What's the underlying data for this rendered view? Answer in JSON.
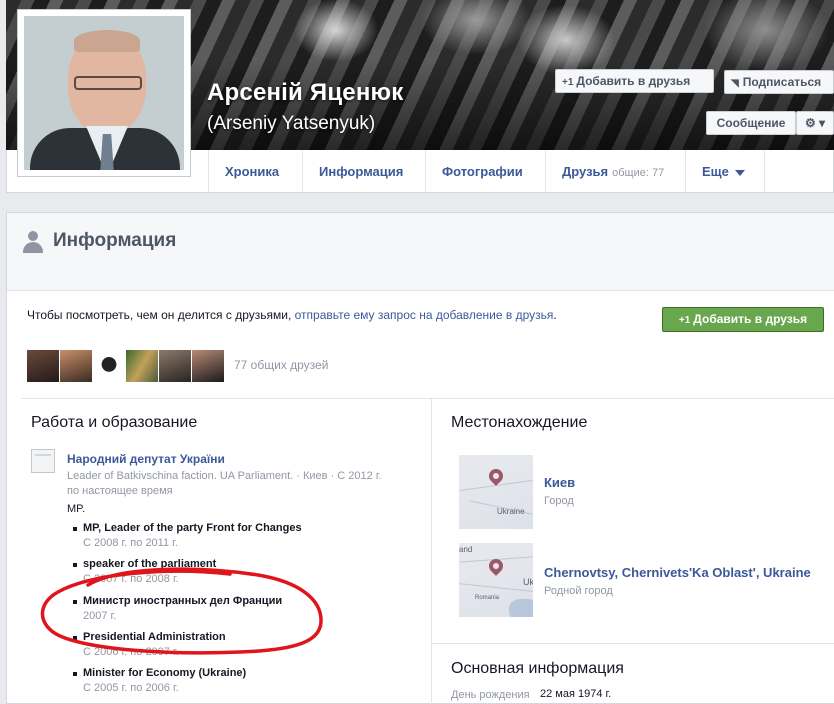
{
  "profile": {
    "name": "Арсеній Яценюк",
    "alt_name": "(Arseniy Yatsenyuk)"
  },
  "header_actions": {
    "add_friend": "Добавить в друзья",
    "add_friend_prefix": "+1",
    "subscribe": "Подписаться",
    "message": "Сообщение",
    "gear": "⚙ ▾"
  },
  "tabs": [
    {
      "label": "Хроника"
    },
    {
      "label": "Информация"
    },
    {
      "label": "Фотографии"
    },
    {
      "label": "Друзья",
      "count": "общие: 77"
    },
    {
      "label": "Еще"
    }
  ],
  "info": {
    "title": "Информация",
    "request_text": "Чтобы посмотреть, чем он делится с друзьями, ",
    "request_link": "отправьте ему запрос на добавление в друзья",
    "request_end": ".",
    "add_friend_button": "Добавить в друзья",
    "add_friend_prefix": "+1",
    "mutual_friends": "77 общих друзей"
  },
  "work": {
    "title": "Работа и образование",
    "job_title": "Народний депутат України",
    "job_desc": "Leader of Batkivschina faction. UA Parliament. · Киев · С 2012 г. по настоящее время",
    "job_role": "MP.",
    "positions": [
      {
        "title": "MP, Leader of the party Front for Changes",
        "dates": "С 2008 г. по 2011 г."
      },
      {
        "title": "speaker of the parliament",
        "dates": "С 2007 г. по 2008 г."
      },
      {
        "title": "Министр иностранных дел Франции",
        "dates": "2007 г."
      },
      {
        "title": "Presidential Administration",
        "dates": "С 2006 г. по 2007 г."
      },
      {
        "title": "Minister for Economy (Ukraine)",
        "dates": "С 2005 г. по 2006 г."
      }
    ]
  },
  "location": {
    "title": "Местонахождение",
    "places": [
      {
        "name": "Киев",
        "type": "Город",
        "map_label": "Ukraine"
      },
      {
        "name": "Chernovtsy, Chernivets'Ka Oblast', Ukraine",
        "type": "Родной город",
        "map_label": "Uk",
        "map_label2": "and",
        "map_label3": "Romania"
      }
    ]
  },
  "basic": {
    "title": "Основная информация",
    "birthday_label": "День рождения",
    "birthday_value": "22 мая 1974 г."
  },
  "colors": {
    "link": "#3b5998",
    "green_button": "#69a74e",
    "annotation_red": "#e0141b"
  }
}
